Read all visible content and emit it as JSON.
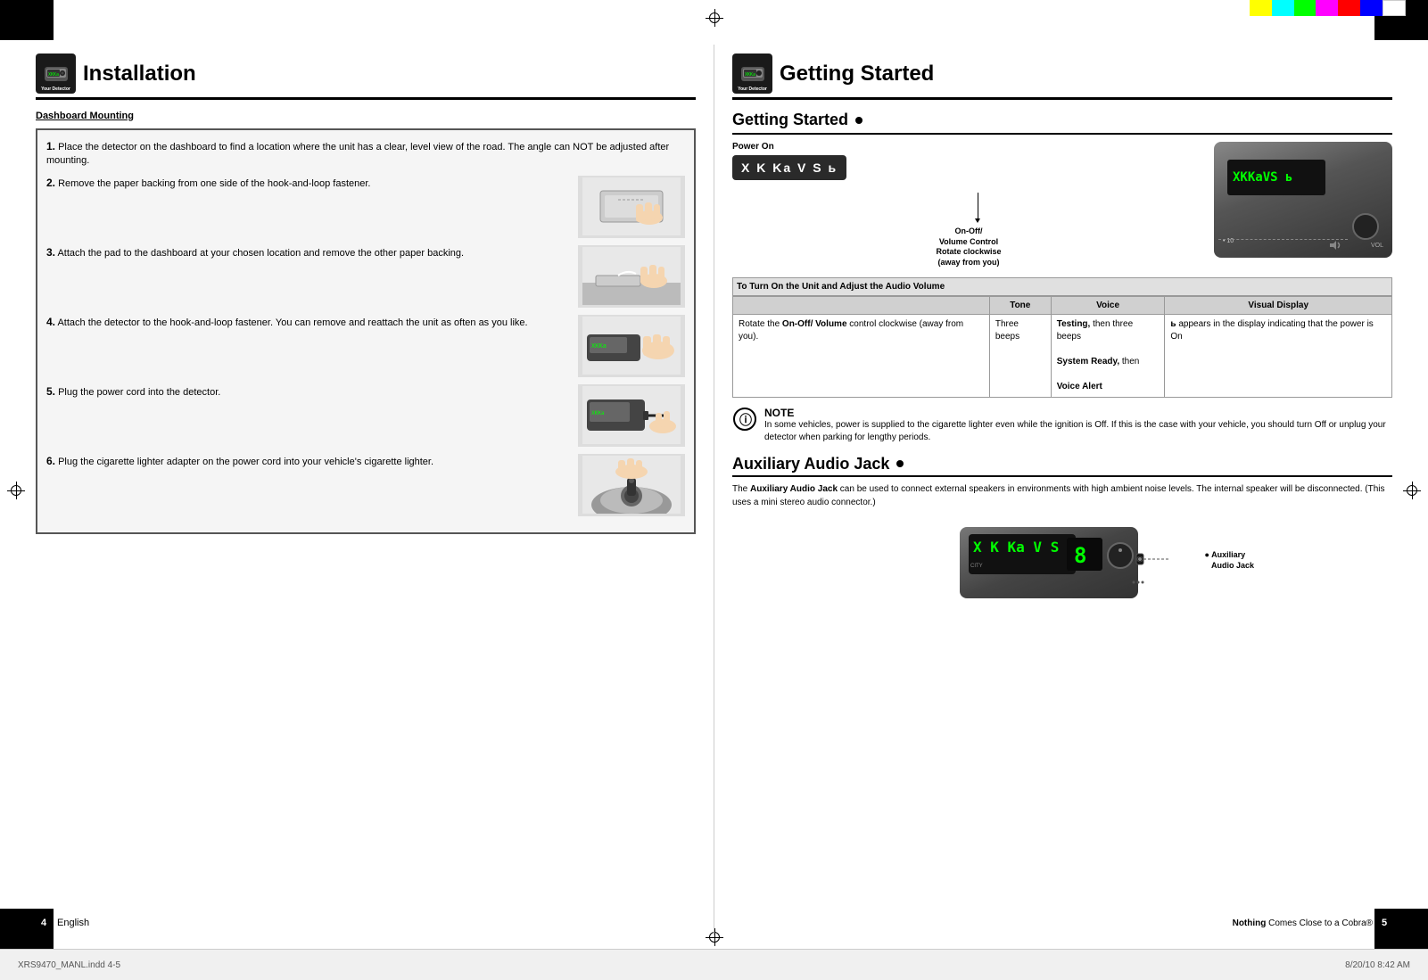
{
  "meta": {
    "file_name": "XRS9470_MANL.indd 4-5",
    "date": "8/20/10  8:42 AM",
    "page_left": "4",
    "page_right": "5",
    "language": "English",
    "brand": "Cobra",
    "tagline": "Nothing Comes Close to a Cobra®"
  },
  "left_page": {
    "header": {
      "detector_label": "Your Detector",
      "title": "Installation"
    },
    "section_title": "Dashboard Mounting",
    "steps": [
      {
        "number": "1.",
        "text": "Place the detector on the dashboard to find a location where the unit has a clear, level view of the road. The angle can NOT be adjusted after mounting.",
        "has_image": false
      },
      {
        "number": "2.",
        "text": "Remove the paper backing from one side of the hook-and-loop fastener.",
        "has_image": true
      },
      {
        "number": "3.",
        "text": "Attach the pad to the dashboard at your chosen location and remove the other paper backing.",
        "has_image": true
      },
      {
        "number": "4.",
        "text": "Attach the detector to the hook-and-loop fastener. You can remove and reattach the unit as often as you like.",
        "has_image": true
      },
      {
        "number": "5.",
        "text": "Plug the power cord into the detector.",
        "has_image": true
      },
      {
        "number": "6.",
        "text": "Plug the cigarette lighter adapter on the power cord into your vehicle's cigarette lighter.",
        "has_image": true
      }
    ]
  },
  "right_page": {
    "header": {
      "detector_label": "Your Detector",
      "title": "Getting Started"
    },
    "getting_started": {
      "title": "Getting Started",
      "power_on_label": "Power On",
      "display_text": "X K Ka V S ь",
      "on_off_label": "On-Off/\nVolume Control\nRotate clockwise\n(away from you)",
      "audio_table": {
        "caption": "To Turn On the Unit and Adjust the Audio Volume",
        "headers": [
          "Rotate the On-Off/ Volume control clockwise (away from you).",
          "Tone",
          "Voice",
          "Visual Display"
        ],
        "row": {
          "col1": "",
          "tone": "Three beeps",
          "voice": "Testing, then three beeps\nSystem Ready, then\nVoice Alert",
          "display": "ь appears in the display indicating that the power is On"
        }
      },
      "note": {
        "label": "NOTE",
        "text": "In some vehicles, power is supplied to the cigarette lighter even while the ignition is Off. If this is the case with your vehicle, you should turn Off or unplug your detector when parking for lengthy periods."
      }
    },
    "auxiliary": {
      "title": "Auxiliary Audio Jack",
      "description": "The Auxiliary Audio Jack can be used to connect external speakers in environments with high ambient noise levels. The internal speaker will be disconnected. (This uses a mini stereo audio connector.)",
      "label": "Auxiliary\nAudio Jack"
    }
  },
  "colors": {
    "color_bar": [
      "#ffff00",
      "#00ffff",
      "#00ff00",
      "#ff00ff",
      "#ff0000",
      "#0000ff",
      "#ffffff",
      "#000000"
    ]
  }
}
